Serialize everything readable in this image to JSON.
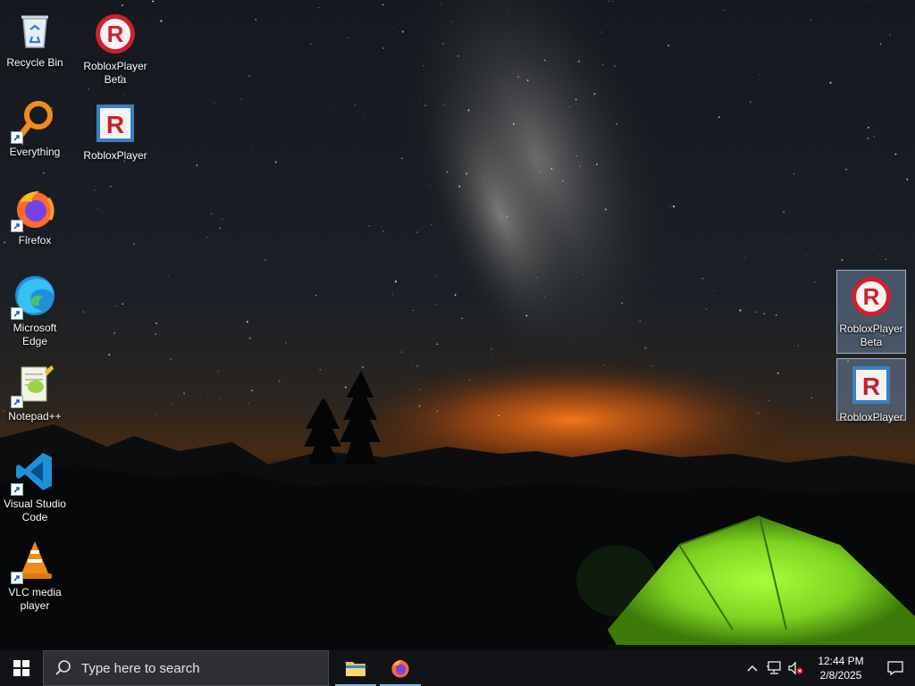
{
  "desktop": {
    "icons": [
      {
        "label": "Recycle Bin",
        "icon": "recycle-bin-icon",
        "shortcut": false
      },
      {
        "label": "Everything",
        "icon": "everything-search-icon",
        "shortcut": true
      },
      {
        "label": "Firefox",
        "icon": "firefox-icon",
        "shortcut": true
      },
      {
        "label": "Microsoft Edge",
        "icon": "edge-icon",
        "shortcut": true
      },
      {
        "label": "Notepad++",
        "icon": "notepad-plus-plus-icon",
        "shortcut": true
      },
      {
        "label": "Visual Studio Code",
        "icon": "vscode-icon",
        "shortcut": true
      },
      {
        "label": "VLC media player",
        "icon": "vlc-icon",
        "shortcut": true
      },
      {
        "label": "RobloxPlayer Beta",
        "icon": "roblox-beta-icon",
        "shortcut": false
      },
      {
        "label": "RobloxPlayer",
        "icon": "roblox-player-icon",
        "shortcut": false
      },
      {
        "label": "RobloxPlayer Beta",
        "icon": "roblox-beta-icon",
        "shortcut": false,
        "selected": true
      },
      {
        "label": "RobloxPlayer",
        "icon": "roblox-player-icon",
        "shortcut": false,
        "selected": true
      }
    ]
  },
  "taskbar": {
    "search_placeholder": "Type here to search",
    "pinned": [
      {
        "name": "File Explorer",
        "icon": "file-explorer-icon",
        "running": true
      },
      {
        "name": "Firefox",
        "icon": "firefox-icon",
        "running": true
      }
    ],
    "tray": {
      "chevron": "chevron-up-icon",
      "network": "network-icon",
      "volume": "volume-muted-icon",
      "time": "12:44 PM",
      "date": "2/8/2025"
    }
  },
  "colors": {
    "taskbar": "#111317",
    "search_box": "#2d2f33",
    "running_indicator": "#76b9ed",
    "tent": "#7ed321",
    "horizon_glow": "#e8761e"
  }
}
